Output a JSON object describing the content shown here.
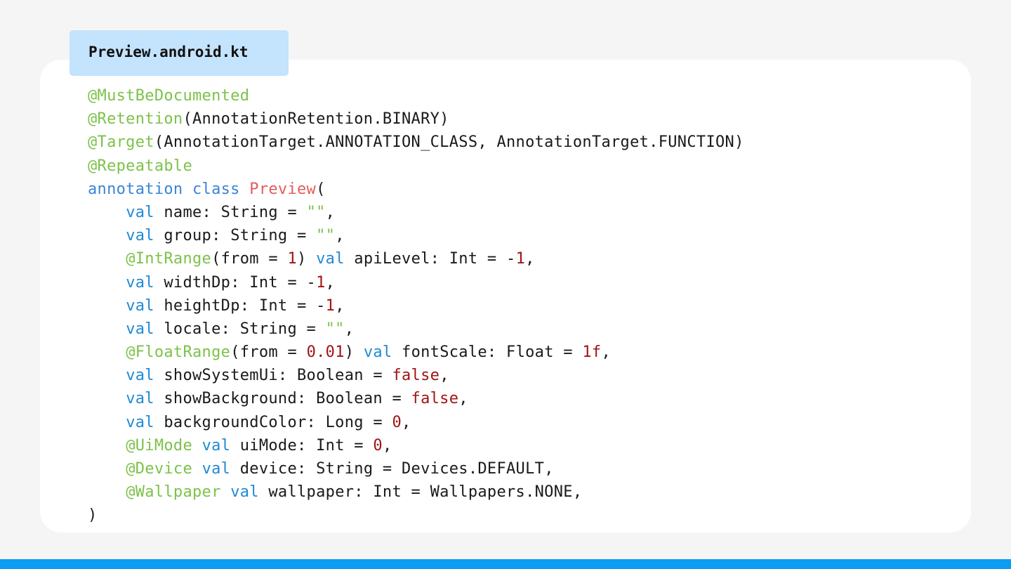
{
  "file_tab": {
    "filename": "Preview.android.kt"
  },
  "colors": {
    "page_background": "#f5f5f5",
    "card_background": "#ffffff",
    "tab_background": "#c4e3fc",
    "annotation": "#7cc24a",
    "keyword": "#3b84d6",
    "val_keyword": "#1f8ad4",
    "class_name": "#e35c5c",
    "string": "#7cc24a",
    "number": "#a01414",
    "plain": "#1a1a1a",
    "bottom_bar": "#0b9df2"
  },
  "code_lines": [
    [
      {
        "t": "@MustBeDocumented",
        "c": "ann"
      }
    ],
    [
      {
        "t": "@Retention",
        "c": "ann"
      },
      {
        "t": "(AnnotationRetention.BINARY)",
        "c": "plain"
      }
    ],
    [
      {
        "t": "@Target",
        "c": "ann"
      },
      {
        "t": "(AnnotationTarget.ANNOTATION_CLASS, AnnotationTarget.FUNCTION)",
        "c": "plain"
      }
    ],
    [
      {
        "t": "@Repeatable",
        "c": "ann"
      }
    ],
    [
      {
        "t": "annotation",
        "c": "kw"
      },
      {
        "t": " ",
        "c": "plain"
      },
      {
        "t": "class",
        "c": "kw"
      },
      {
        "t": " ",
        "c": "plain"
      },
      {
        "t": "Preview",
        "c": "cls"
      },
      {
        "t": "(",
        "c": "plain"
      }
    ],
    [
      {
        "t": "    ",
        "c": "plain"
      },
      {
        "t": "val",
        "c": "val"
      },
      {
        "t": " name: String = ",
        "c": "plain"
      },
      {
        "t": "\"\"",
        "c": "str"
      },
      {
        "t": ",",
        "c": "plain"
      }
    ],
    [
      {
        "t": "    ",
        "c": "plain"
      },
      {
        "t": "val",
        "c": "val"
      },
      {
        "t": " group: String = ",
        "c": "plain"
      },
      {
        "t": "\"\"",
        "c": "str"
      },
      {
        "t": ",",
        "c": "plain"
      }
    ],
    [
      {
        "t": "    ",
        "c": "plain"
      },
      {
        "t": "@IntRange",
        "c": "ann"
      },
      {
        "t": "(from = ",
        "c": "plain"
      },
      {
        "t": "1",
        "c": "num"
      },
      {
        "t": ") ",
        "c": "plain"
      },
      {
        "t": "val",
        "c": "val"
      },
      {
        "t": " apiLevel: Int = -",
        "c": "plain"
      },
      {
        "t": "1",
        "c": "num"
      },
      {
        "t": ",",
        "c": "plain"
      }
    ],
    [
      {
        "t": "    ",
        "c": "plain"
      },
      {
        "t": "val",
        "c": "val"
      },
      {
        "t": " widthDp: Int = -",
        "c": "plain"
      },
      {
        "t": "1",
        "c": "num"
      },
      {
        "t": ",",
        "c": "plain"
      }
    ],
    [
      {
        "t": "    ",
        "c": "plain"
      },
      {
        "t": "val",
        "c": "val"
      },
      {
        "t": " heightDp: Int = -",
        "c": "plain"
      },
      {
        "t": "1",
        "c": "num"
      },
      {
        "t": ",",
        "c": "plain"
      }
    ],
    [
      {
        "t": "    ",
        "c": "plain"
      },
      {
        "t": "val",
        "c": "val"
      },
      {
        "t": " locale: String = ",
        "c": "plain"
      },
      {
        "t": "\"\"",
        "c": "str"
      },
      {
        "t": ",",
        "c": "plain"
      }
    ],
    [
      {
        "t": "    ",
        "c": "plain"
      },
      {
        "t": "@FloatRange",
        "c": "ann"
      },
      {
        "t": "(from = ",
        "c": "plain"
      },
      {
        "t": "0.01",
        "c": "num"
      },
      {
        "t": ") ",
        "c": "plain"
      },
      {
        "t": "val",
        "c": "val"
      },
      {
        "t": " fontScale: Float = ",
        "c": "plain"
      },
      {
        "t": "1f",
        "c": "num"
      },
      {
        "t": ",",
        "c": "plain"
      }
    ],
    [
      {
        "t": "    ",
        "c": "plain"
      },
      {
        "t": "val",
        "c": "val"
      },
      {
        "t": " showSystemUi: Boolean = ",
        "c": "plain"
      },
      {
        "t": "false",
        "c": "num"
      },
      {
        "t": ",",
        "c": "plain"
      }
    ],
    [
      {
        "t": "    ",
        "c": "plain"
      },
      {
        "t": "val",
        "c": "val"
      },
      {
        "t": " showBackground: Boolean = ",
        "c": "plain"
      },
      {
        "t": "false",
        "c": "num"
      },
      {
        "t": ",",
        "c": "plain"
      }
    ],
    [
      {
        "t": "    ",
        "c": "plain"
      },
      {
        "t": "val",
        "c": "val"
      },
      {
        "t": " backgroundColor: Long = ",
        "c": "plain"
      },
      {
        "t": "0",
        "c": "num"
      },
      {
        "t": ",",
        "c": "plain"
      }
    ],
    [
      {
        "t": "    ",
        "c": "plain"
      },
      {
        "t": "@UiMode",
        "c": "ann"
      },
      {
        "t": " ",
        "c": "plain"
      },
      {
        "t": "val",
        "c": "val"
      },
      {
        "t": " uiMode: Int = ",
        "c": "plain"
      },
      {
        "t": "0",
        "c": "num"
      },
      {
        "t": ",",
        "c": "plain"
      }
    ],
    [
      {
        "t": "    ",
        "c": "plain"
      },
      {
        "t": "@Device",
        "c": "ann"
      },
      {
        "t": " ",
        "c": "plain"
      },
      {
        "t": "val",
        "c": "val"
      },
      {
        "t": " device: String = Devices.DEFAULT,",
        "c": "plain"
      }
    ],
    [
      {
        "t": "    ",
        "c": "plain"
      },
      {
        "t": "@Wallpaper",
        "c": "ann"
      },
      {
        "t": " ",
        "c": "plain"
      },
      {
        "t": "val",
        "c": "val"
      },
      {
        "t": " wallpaper: Int = Wallpapers.NONE,",
        "c": "plain"
      }
    ],
    [
      {
        "t": ")",
        "c": "plain"
      }
    ]
  ]
}
